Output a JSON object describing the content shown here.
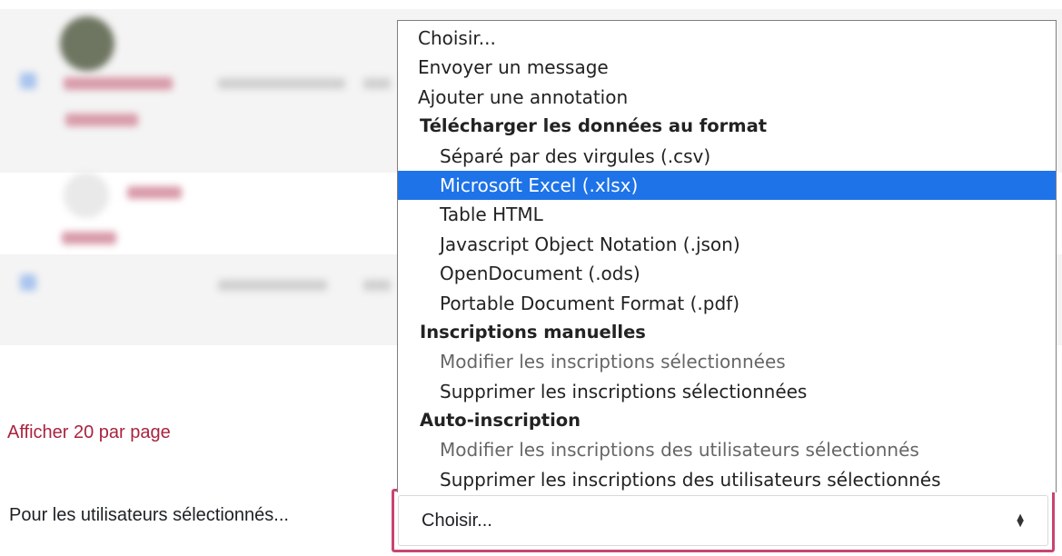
{
  "pagination": {
    "per_page_link": "Afficher 20 par page"
  },
  "bulk_action": {
    "label": "Pour les utilisateurs sélectionnés...",
    "selected_value": "Choisir..."
  },
  "dropdown": {
    "options": [
      {
        "label": "Choisir...",
        "kind": "option"
      },
      {
        "label": "Envoyer un message",
        "kind": "option"
      },
      {
        "label": "Ajouter une annotation",
        "kind": "option"
      },
      {
        "label": "Télécharger les données au format",
        "kind": "group"
      },
      {
        "label": "Séparé par des virgules (.csv)",
        "kind": "sub"
      },
      {
        "label": "Microsoft Excel (.xlsx)",
        "kind": "sub",
        "selected": true
      },
      {
        "label": "Table HTML",
        "kind": "sub"
      },
      {
        "label": "Javascript Object Notation (.json)",
        "kind": "sub"
      },
      {
        "label": "OpenDocument (.ods)",
        "kind": "sub"
      },
      {
        "label": "Portable Document Format (.pdf)",
        "kind": "sub"
      },
      {
        "label": "Inscriptions manuelles",
        "kind": "group"
      },
      {
        "label": "Modifier les inscriptions sélectionnées",
        "kind": "sub",
        "muted": true
      },
      {
        "label": "Supprimer les inscriptions sélectionnées",
        "kind": "sub"
      },
      {
        "label": "Auto-inscription",
        "kind": "group"
      },
      {
        "label": "Modifier les inscriptions des utilisateurs sélectionnés",
        "kind": "sub",
        "muted": true
      },
      {
        "label": "Supprimer les inscriptions des utilisateurs sélectionnés",
        "kind": "sub"
      }
    ]
  },
  "colors": {
    "accent_link": "#a8243f",
    "focus_border": "#c7466f",
    "selection": "#1e73e8"
  },
  "icons": {
    "select_arrows": "sort-up-down-icon"
  }
}
